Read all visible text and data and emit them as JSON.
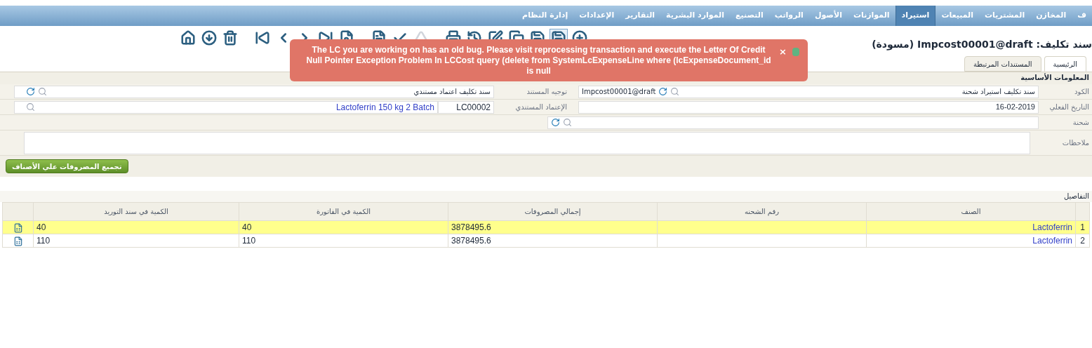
{
  "menu": [
    {
      "label": "ف",
      "selected": false
    },
    {
      "label": "المخازن",
      "selected": false
    },
    {
      "label": "المشتريات",
      "selected": false
    },
    {
      "label": "المبيعات",
      "selected": false
    },
    {
      "label": "استيراد",
      "selected": true
    },
    {
      "label": "الموازنات",
      "selected": false
    },
    {
      "label": "الأصول",
      "selected": false
    },
    {
      "label": "الرواتب",
      "selected": false
    },
    {
      "label": "التصنيع",
      "selected": false
    },
    {
      "label": "الموارد البشرية",
      "selected": false
    },
    {
      "label": "التقارير",
      "selected": false
    },
    {
      "label": "الإعدادات",
      "selected": false
    },
    {
      "label": "إدارة النظام",
      "selected": false
    }
  ],
  "title": "سند تكليف: Impcost00001@draft (مسودة)",
  "toolbar": [
    {
      "kind": "plus",
      "disabled": false,
      "selected": false
    },
    {
      "kind": "save",
      "disabled": false,
      "selected": true
    },
    {
      "kind": "save",
      "disabled": false,
      "selected": false
    },
    {
      "kind": "copy",
      "disabled": false,
      "selected": false
    },
    {
      "kind": "edit",
      "disabled": false,
      "selected": false
    },
    {
      "kind": "history",
      "disabled": false,
      "selected": false
    },
    {
      "kind": "print",
      "disabled": false,
      "selected": false
    },
    {
      "kind": "up",
      "disabled": true,
      "selected": false
    },
    {
      "kind": "check",
      "disabled": false,
      "selected": false
    },
    {
      "kind": "doc",
      "disabled": false,
      "selected": false
    },
    {
      "kind": "find",
      "disabled": false,
      "selected": false
    },
    {
      "kind": "last",
      "disabled": false,
      "selected": false
    },
    {
      "kind": "next",
      "disabled": false,
      "selected": false
    },
    {
      "kind": "prev",
      "disabled": false,
      "selected": false
    },
    {
      "kind": "first",
      "disabled": false,
      "selected": false
    },
    {
      "kind": "trash",
      "disabled": false,
      "selected": false
    },
    {
      "kind": "down",
      "disabled": false,
      "selected": false
    },
    {
      "kind": "home",
      "disabled": false,
      "selected": false
    }
  ],
  "notification": {
    "close": "×",
    "message": "The LC you are working on has an old bug. Please visit reprocessing transaction and execute the Letter Of Credit Null Pointer Exception Problem In LCCost query (delete from SystemLcExpenseLine where (lcExpenseDocument_id is null"
  },
  "tabs": [
    {
      "label": "الرئيسية",
      "selected": true
    },
    {
      "label": "المستندات المرتبطة",
      "selected": false
    }
  ],
  "section": "المعلومات الأساسية",
  "form": {
    "code": {
      "label": "الكود",
      "type": "سند تكليف استيراد شحنة",
      "value": "Impcost00001@draft"
    },
    "direction": {
      "label": "توجيه المستند",
      "value": "سند تكليف اعتماد مستندي"
    },
    "date": {
      "label": "التاريخ الفعلي",
      "value": "16-02-2019"
    },
    "lc": {
      "label": "الإعتماد المستندي",
      "code": "LC00002",
      "name": "Lactoferrin 150 kg 2 Batch"
    },
    "shipment": {
      "label": "شحنة"
    },
    "notes": {
      "label": "ملاحظات"
    }
  },
  "action_button": "تجميع المصروفات علي الأصناف",
  "details": {
    "title": "التفاصيل",
    "columns": [
      "الصنف",
      "رقم الشحنه",
      "إجمالي المصروفات",
      "الكمية في الفاتورة",
      "الكمية في سند التوريد"
    ],
    "rows": [
      {
        "index": "1",
        "item": "Lactoferrin",
        "shipment": "",
        "total": "3878495.6",
        "invoice_qty": "40",
        "receipt_qty": "40",
        "selected": true
      },
      {
        "index": "2",
        "item": "Lactoferrin",
        "shipment": "",
        "total": "3878495.6",
        "invoice_qty": "110",
        "receipt_qty": "110",
        "selected": false
      }
    ]
  }
}
